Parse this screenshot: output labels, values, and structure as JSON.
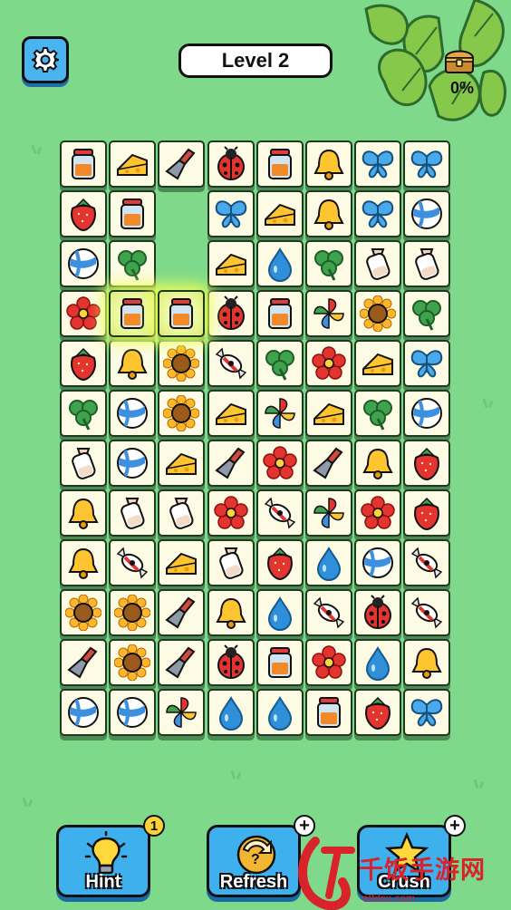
{
  "header": {
    "level_label": "Level 2",
    "chest_progress": "0%"
  },
  "board": {
    "rows": [
      [
        "jar",
        "cheese",
        "scraper",
        "ladybug",
        "jar",
        "bell",
        "butterfly",
        "butterfly"
      ],
      [
        "strawberry",
        "jar",
        null,
        null,
        "butterfly",
        "cheese",
        "bell",
        "butterfly",
        "ball"
      ],
      [
        "ball",
        "clover",
        null,
        "cheese",
        "drop",
        "clover",
        "bottle",
        "bottle"
      ],
      [
        "flower",
        "jar*",
        "jar*",
        "ladybug",
        "jar",
        "pinwheel",
        "sunflower",
        "clover"
      ],
      [
        "strawberry",
        "bell",
        "sunflower",
        "candy",
        "clover",
        "flower",
        "cheese",
        "butterfly"
      ],
      [
        "clover",
        "ball",
        "sunflower",
        "cheese",
        "pinwheel",
        "cheese",
        "clover",
        "ball"
      ],
      [
        "bottle",
        "ball",
        "cheese",
        "scraper",
        "flower",
        "scraper",
        "bell",
        "strawberry"
      ],
      [
        "bell",
        "bottle",
        "bottle",
        "flower",
        "candy",
        "pinwheel",
        "flower",
        "strawberry"
      ],
      [
        "bell",
        "candy",
        "cheese",
        "bottle",
        "strawberry",
        "drop",
        "ball",
        "candy"
      ],
      [
        "sunflower",
        "sunflower",
        "scraper",
        "bell",
        "drop",
        "candy",
        "ladybug",
        "candy"
      ],
      [
        "scraper",
        "sunflower",
        "scraper",
        "ladybug",
        "jar",
        "flower",
        "drop",
        "bell"
      ],
      [
        "ball",
        "ball",
        "pinwheel",
        "drop",
        "drop",
        "jar",
        "strawberry",
        "butterfly"
      ]
    ]
  },
  "buttons": {
    "hint": {
      "label": "Hint",
      "count": "1",
      "icon": "lightbulb-icon"
    },
    "refresh": {
      "label": "Refresh",
      "icon": "refresh-icon"
    },
    "crush": {
      "label": "Crush",
      "icon": "star-icon"
    },
    "plus": "+"
  },
  "watermark": {
    "text": "千饭手游网",
    "url": "etfdsx.com"
  },
  "colors": {
    "background": "#7ed98a",
    "tile": "#fdfbe4",
    "button": "#3fb0ee"
  }
}
